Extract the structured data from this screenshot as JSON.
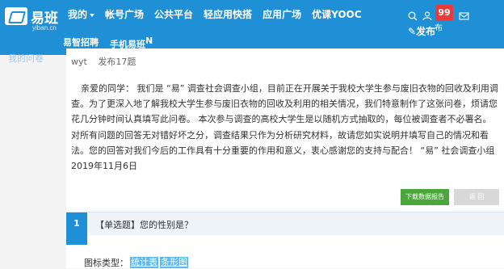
{
  "header": {
    "logo_text": "易班",
    "logo_sub": "yiban.cn",
    "nav": [
      "我的",
      "帐号广场",
      "公共平台",
      "轻应用快搭",
      "应用广场",
      "优课YOOC"
    ],
    "nav2": [
      "易智招聘",
      "手机易班"
    ],
    "nav2_sup": "N",
    "left_partial": "我的问卷",
    "notify_count": "99",
    "notify_sub": "布",
    "publish": "发布"
  },
  "survey": {
    "author": "wyt",
    "published": "发布17题",
    "description": "亲爱的同学： 我们是 “易” 调查社会调查小组，目前正在开展关于我校大学生参与废旧衣物的回收及利用调查。为了更深入地了解我校大学生参与废旧衣物的回收及利用的相关情况，我们特意制作了这张问卷，烦请您花几分钟时间认真填写此问卷。 本次参与调查的高校大学生是以随机方式抽取的，每位被调查者不必署名。对所有问题的回答无对错好坏之分，调查结果只作为分析研究材料，故请您如实说明并填写自己的情况和看法。您的回答对我们今后的工作具有十分重要的作用和意义，衷心感谢您的支持与配合！ “易” 社会调查小组 2019年11月6日",
    "download_label": "下载数据报告",
    "back_label": "返 回"
  },
  "question": {
    "number": "1",
    "text": "【单选题】您的性别是？",
    "chart_type_label": "图标类型：",
    "chart_types": [
      "统计表",
      "条形图"
    ]
  },
  "colors": {
    "brand": "#1f8fd6",
    "download": "#4aa63a",
    "badge": "#e83b3b"
  }
}
